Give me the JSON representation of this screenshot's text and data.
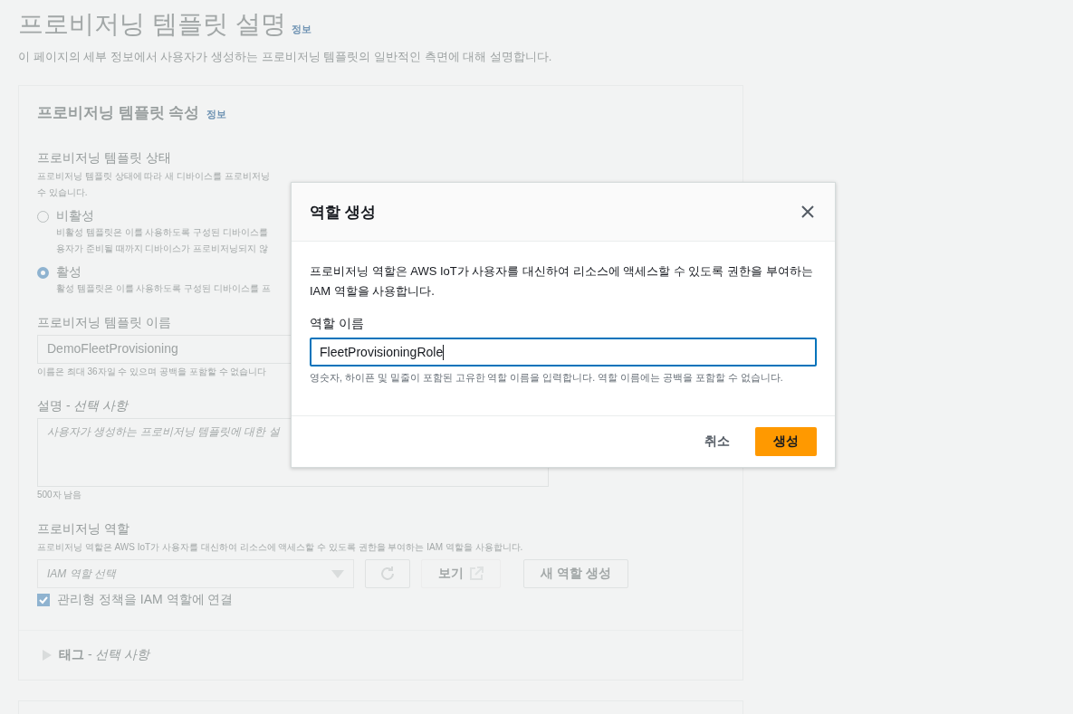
{
  "page": {
    "title": "프로비저닝 템플릿 설명",
    "info_link": "정보",
    "description": "이 페이지의 세부 정보에서 사용자가 생성하는 프로비저닝 템플릿의 일반적인 측면에 대해 설명합니다."
  },
  "properties_card": {
    "heading": "프로비저닝 템플릿 속성",
    "info_link": "정보",
    "status": {
      "label": "프로비저닝 템플릿 상태",
      "description_lines": [
        "프로비저닝 템플릿 상태에 따라 새 디바이스를 프로비저닝",
        "수 있습니다."
      ],
      "options": [
        {
          "label": "비활성",
          "selected": false,
          "description_lines": [
            "비활성 템플릿은 이를 사용하도록 구성된 디바이스를",
            "용자가 준비될 때까지 디바이스가 프로비저닝되지 않"
          ]
        },
        {
          "label": "활성",
          "selected": true,
          "description_lines": [
            "활성 템플릿은 이를 사용하도록 구성된 디바이스를 프"
          ]
        }
      ]
    },
    "name": {
      "label": "프로비저닝 템플릿 이름",
      "value": "DemoFleetProvisioning",
      "hint": "이름은 최대 36자일 수 있으며 공백을 포함할 수 없습니다"
    },
    "description_field": {
      "label": "설명 - *선택 사항*",
      "placeholder": "사용자가 생성하는 프로비저닝 템플릿에 대한 설",
      "counter": "500자 남음"
    },
    "role": {
      "label": "프로비저닝 역할",
      "description": "프로비저닝 역할은 AWS IoT가 사용자를 대신하여 리소스에 액세스할 수 있도록 권한을 부여하는 IAM 역할을 사용합니다.",
      "select_placeholder": "IAM 역할 선택",
      "view_button": "보기",
      "create_button": "새 역할 생성",
      "attach_policy": {
        "label": "관리형 정책을 IAM 역할에 연결",
        "checked": true
      }
    },
    "tags": {
      "label": "**태그** - *선택 사항*",
      "expanded": false
    }
  },
  "modal": {
    "title": "역할 생성",
    "description": "프로비저닝 역할은 AWS IoT가 사용자를 대신하여 리소스에 액세스할 수 있도록 권한을 부여하는 IAM 역할을 사용합니다.",
    "field_label": "역할 이름",
    "field_value": "FleetProvisioningRole",
    "field_hint": "영숫자, 하이픈 및 밑줄이 포함된 고유한 역할 이름을 입력합니다. 역할 이름에는 공백을 포함할 수 없습니다.",
    "cancel_button": "취소",
    "create_button": "생성"
  }
}
